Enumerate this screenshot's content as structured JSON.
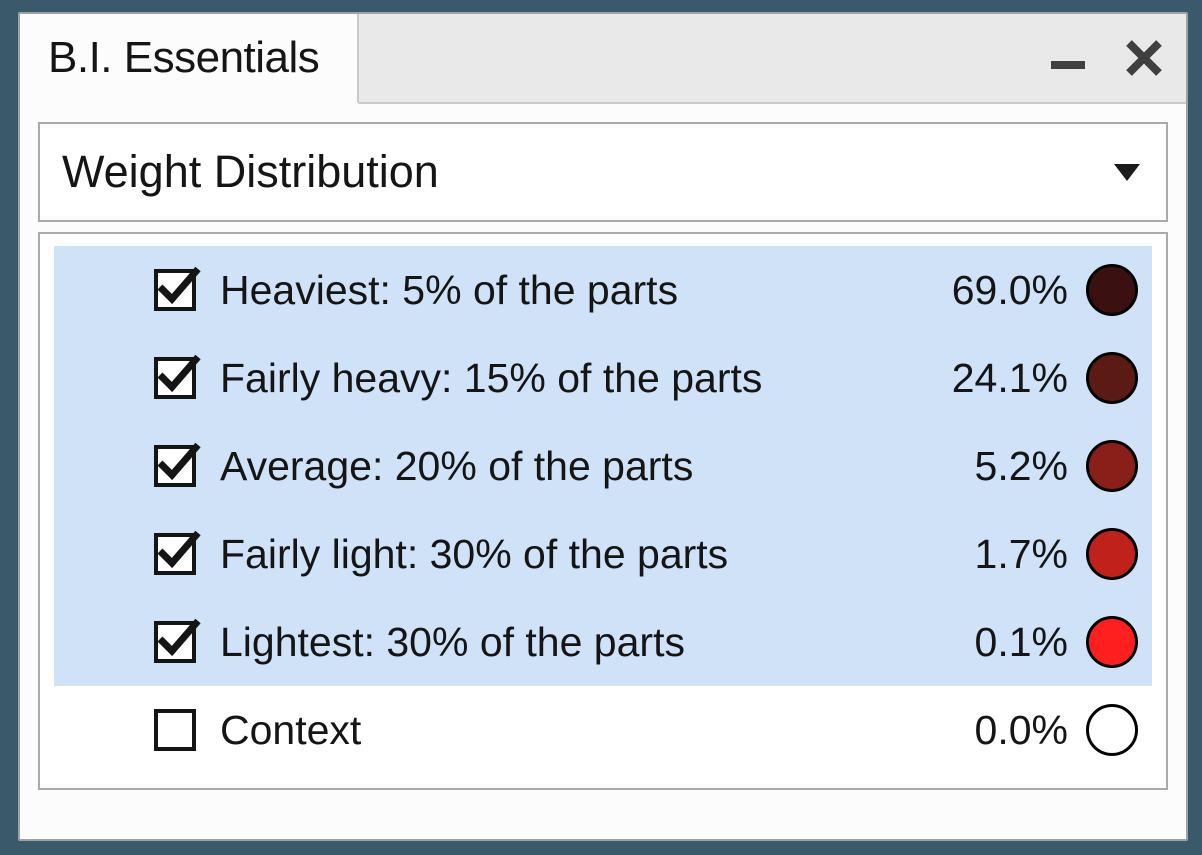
{
  "panel": {
    "title": "B.I. Essentials"
  },
  "dropdown": {
    "selected": "Weight Distribution"
  },
  "rows": [
    {
      "checked": true,
      "label": "Heaviest: 5% of the parts",
      "pct": "69.0%",
      "color": "#3a1010",
      "highlight": true
    },
    {
      "checked": true,
      "label": "Fairly heavy: 15% of the parts",
      "pct": "24.1%",
      "color": "#5b1a14",
      "highlight": true
    },
    {
      "checked": true,
      "label": "Average: 20% of the parts",
      "pct": "5.2%",
      "color": "#8a1e18",
      "highlight": true
    },
    {
      "checked": true,
      "label": "Fairly light: 30% of the parts",
      "pct": "1.7%",
      "color": "#c1211b",
      "highlight": true
    },
    {
      "checked": true,
      "label": "Lightest: 30% of the parts",
      "pct": "0.1%",
      "color": "#ff1f1f",
      "highlight": true
    },
    {
      "checked": false,
      "label": "Context",
      "pct": "0.0%",
      "color": "#ffffff",
      "highlight": false
    }
  ]
}
